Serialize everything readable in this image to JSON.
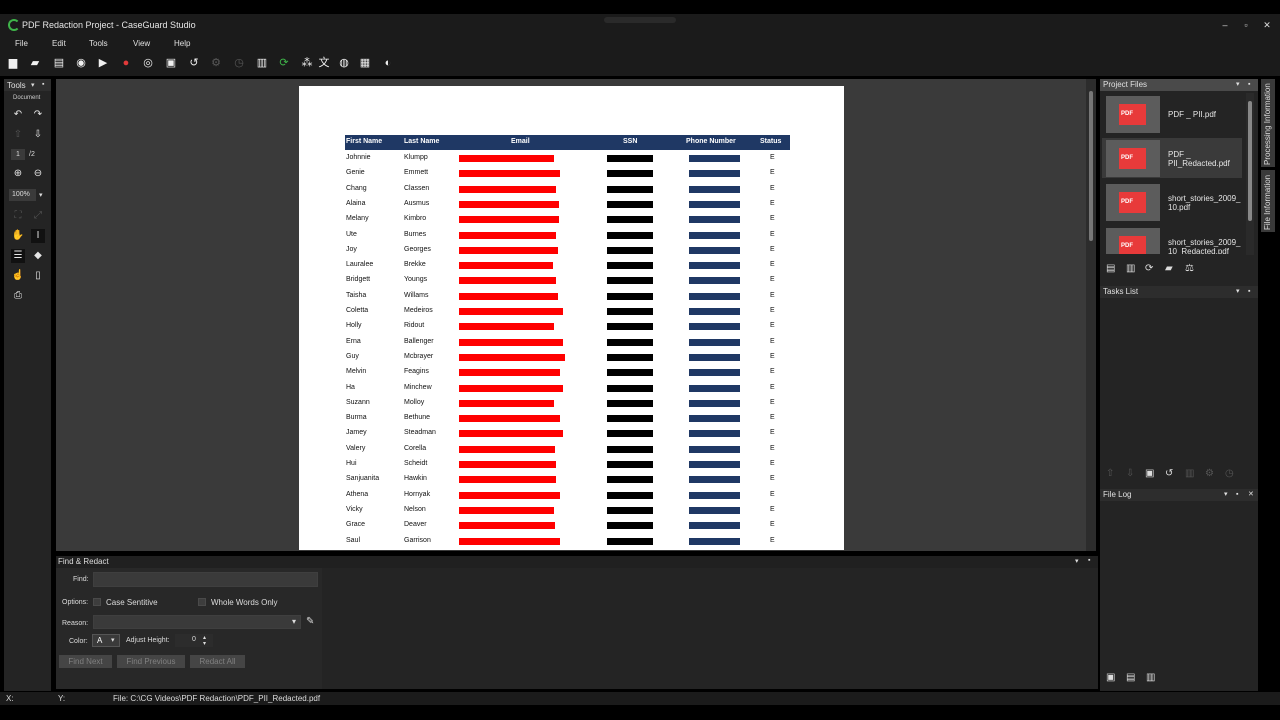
{
  "window": {
    "title": "PDF Redaction Project - CaseGuard Studio"
  },
  "menu": [
    "File",
    "Edit",
    "Tools",
    "View",
    "Help"
  ],
  "tools_panel": {
    "title": "Tools",
    "section": "Document",
    "page_current": "1",
    "page_total": "/2",
    "zoom": "100%"
  },
  "table": {
    "headers": [
      "First Name",
      "Last Name",
      "Email",
      "SSN",
      "Phone Number",
      "Status"
    ],
    "rows": [
      {
        "first": "Johnnie",
        "last": "Klumpp",
        "email_len": 0.85,
        "status": "E"
      },
      {
        "first": "Genie",
        "last": "Emmett",
        "email_len": 0.9,
        "status": "E"
      },
      {
        "first": "Chang",
        "last": "Classen",
        "email_len": 0.87,
        "status": "E"
      },
      {
        "first": "Alaina",
        "last": "Ausmus",
        "email_len": 0.89,
        "status": "E"
      },
      {
        "first": "Melany",
        "last": "Kimbro",
        "email_len": 0.89,
        "status": "E"
      },
      {
        "first": "Ute",
        "last": "Burnes",
        "email_len": 0.87,
        "status": "E"
      },
      {
        "first": "Joy",
        "last": "Georges",
        "email_len": 0.88,
        "status": "E"
      },
      {
        "first": "Lauralee",
        "last": "Brekke",
        "email_len": 0.84,
        "status": "E"
      },
      {
        "first": "Bridgett",
        "last": "Youngs",
        "email_len": 0.87,
        "status": "E"
      },
      {
        "first": "Taisha",
        "last": "Willams",
        "email_len": 0.88,
        "status": "E"
      },
      {
        "first": "Coletta",
        "last": "Medeiros",
        "email_len": 0.93,
        "status": "E"
      },
      {
        "first": "Holly",
        "last": "Ridout",
        "email_len": 0.85,
        "status": "E"
      },
      {
        "first": "Erna",
        "last": "Ballenger",
        "email_len": 0.93,
        "status": "E"
      },
      {
        "first": "Guy",
        "last": "Mcbrayer",
        "email_len": 0.95,
        "status": "E"
      },
      {
        "first": "Melvin",
        "last": "Feagins",
        "email_len": 0.9,
        "status": "E"
      },
      {
        "first": "Ha",
        "last": "Minchew",
        "email_len": 0.93,
        "status": "E"
      },
      {
        "first": "Suzann",
        "last": "Molloy",
        "email_len": 0.85,
        "status": "E"
      },
      {
        "first": "Burma",
        "last": "Bethune",
        "email_len": 0.9,
        "status": "E"
      },
      {
        "first": "Jamey",
        "last": "Steadman",
        "email_len": 0.93,
        "status": "E"
      },
      {
        "first": "Valery",
        "last": "Corella",
        "email_len": 0.86,
        "status": "E"
      },
      {
        "first": "Hui",
        "last": "Scheidt",
        "email_len": 0.87,
        "status": "E"
      },
      {
        "first": "Sanjuanita",
        "last": "Hawkin",
        "email_len": 0.87,
        "status": "E"
      },
      {
        "first": "Athena",
        "last": "Hornyak",
        "email_len": 0.9,
        "status": "E"
      },
      {
        "first": "Vicky",
        "last": "Nelson",
        "email_len": 0.85,
        "status": "E"
      },
      {
        "first": "Grace",
        "last": "Deaver",
        "email_len": 0.86,
        "status": "E"
      },
      {
        "first": "Saul",
        "last": "Garrison",
        "email_len": 0.9,
        "status": "E"
      }
    ]
  },
  "find_panel": {
    "title": "Find & Redact",
    "find_label": "Find:",
    "options_label": "Options:",
    "case_sensitive": "Case Sentitive",
    "whole_words": "Whole Words Only",
    "reason_label": "Reason:",
    "color_label": "Color:",
    "color_glyph": "A",
    "adjust_label": "Adjust Height:",
    "adjust_value": "0",
    "find_next": "Find Next",
    "find_previous": "Find Previous",
    "redact_all": "Redact All"
  },
  "project_files": {
    "title": "Project Files",
    "files": [
      "PDF _ PII.pdf",
      "PDF _\nPII_Redacted.pdf",
      "short_stories_2009_\n10.pdf",
      "short_stories_2009_\n10_Redacted.pdf"
    ],
    "pdf_badge": "PDF"
  },
  "tasks_list": {
    "title": "Tasks List"
  },
  "file_log": {
    "title": "File Log"
  },
  "side_tabs": [
    "Processing Information",
    "File Information"
  ],
  "status": {
    "x": "X:",
    "y": "Y:",
    "file": "File: C:\\CG Videos\\PDF Redaction\\PDF_PII_Redacted.pdf"
  }
}
